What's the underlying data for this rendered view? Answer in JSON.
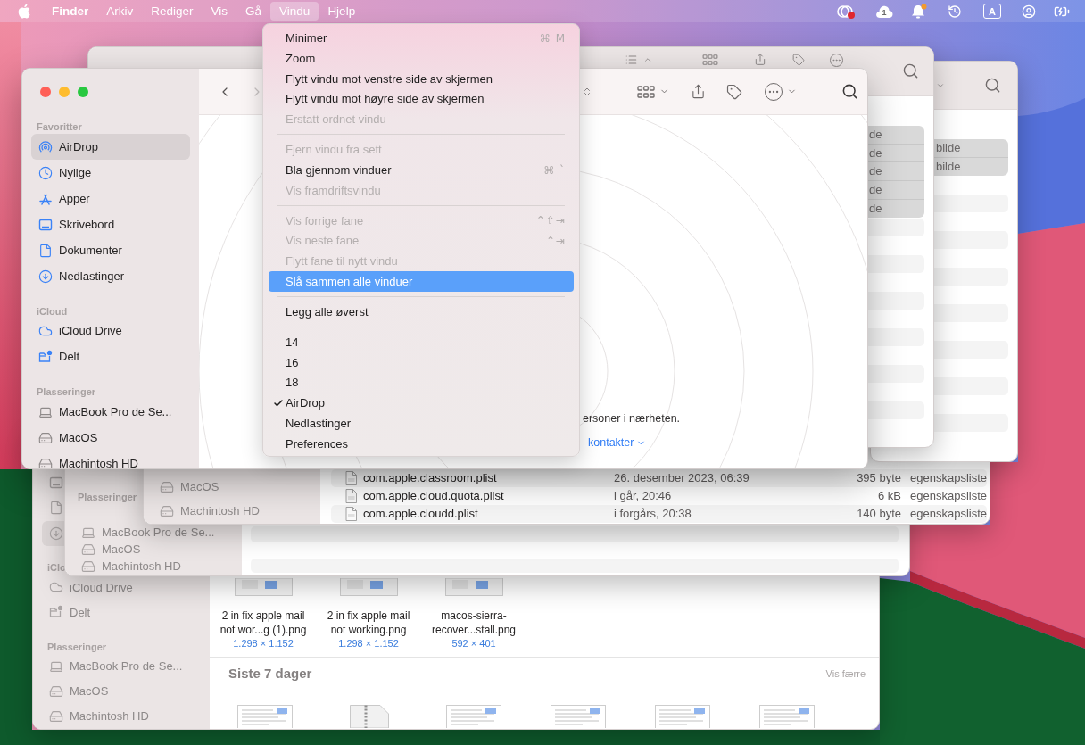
{
  "menu_bar": {
    "items": [
      {
        "label": "Finder",
        "kind": "app",
        "selected": false
      },
      {
        "label": "Arkiv",
        "kind": "menu",
        "selected": false
      },
      {
        "label": "Rediger",
        "kind": "menu",
        "selected": false
      },
      {
        "label": "Vis",
        "kind": "menu",
        "selected": false
      },
      {
        "label": "Gå",
        "kind": "menu",
        "selected": false
      },
      {
        "label": "Vindu",
        "kind": "menu",
        "selected": true
      },
      {
        "label": "Hjelp",
        "kind": "menu",
        "selected": false
      }
    ],
    "status_badge": "1",
    "input_source": "A"
  },
  "window_menu": {
    "entries": [
      {
        "kind": "item",
        "label": "Minimer",
        "shortcut": "⌘ M",
        "disabled": false,
        "selected": false,
        "checked": false
      },
      {
        "kind": "item",
        "label": "Zoom",
        "disabled": false,
        "selected": false,
        "checked": false
      },
      {
        "kind": "item",
        "label": "Flytt vindu mot venstre side av skjermen",
        "disabled": false,
        "selected": false,
        "checked": false
      },
      {
        "kind": "item",
        "label": "Flytt vindu mot høyre side av skjermen",
        "disabled": false,
        "selected": false,
        "checked": false
      },
      {
        "kind": "item",
        "label": "Erstatt ordnet vindu",
        "disabled": true,
        "selected": false,
        "checked": false
      },
      {
        "kind": "separator"
      },
      {
        "kind": "item",
        "label": "Fjern vindu fra sett",
        "disabled": true,
        "selected": false,
        "checked": false
      },
      {
        "kind": "item",
        "label": "Bla gjennom vinduer",
        "shortcut": "⌘ `",
        "disabled": false,
        "selected": false,
        "checked": false
      },
      {
        "kind": "item",
        "label": "Vis framdriftsvindu",
        "disabled": true,
        "selected": false,
        "checked": false
      },
      {
        "kind": "separator"
      },
      {
        "kind": "item",
        "label": "Vis forrige fane",
        "shortcut": "⌃⇧⇥",
        "disabled": true,
        "selected": false,
        "checked": false
      },
      {
        "kind": "item",
        "label": "Vis neste fane",
        "shortcut": "⌃⇥",
        "disabled": true,
        "selected": false,
        "checked": false
      },
      {
        "kind": "item",
        "label": "Flytt fane til nytt vindu",
        "disabled": true,
        "selected": false,
        "checked": false
      },
      {
        "kind": "item",
        "label": "Slå sammen alle vinduer",
        "disabled": false,
        "selected": true,
        "checked": false
      },
      {
        "kind": "separator"
      },
      {
        "kind": "item",
        "label": "Legg alle øverst",
        "disabled": false,
        "selected": false,
        "checked": false
      },
      {
        "kind": "separator"
      },
      {
        "kind": "item",
        "label": "14",
        "disabled": false,
        "selected": false,
        "checked": false
      },
      {
        "kind": "item",
        "label": "16",
        "disabled": false,
        "selected": false,
        "checked": false
      },
      {
        "kind": "item",
        "label": "18",
        "disabled": false,
        "selected": false,
        "checked": false
      },
      {
        "kind": "item",
        "label": "AirDrop",
        "disabled": false,
        "selected": false,
        "checked": true
      },
      {
        "kind": "item",
        "label": "Nedlastinger",
        "disabled": false,
        "selected": false,
        "checked": false
      },
      {
        "kind": "item",
        "label": "Preferences",
        "disabled": false,
        "selected": false,
        "checked": false
      }
    ]
  },
  "finder_window": {
    "navigation": {
      "back_disabled": false,
      "forward_disabled": true
    },
    "sidebar": {
      "sections": [
        {
          "title": "Favoritter",
          "items": [
            {
              "label": "AirDrop",
              "kind": "airdrop",
              "selected": true
            },
            {
              "label": "Nylige",
              "kind": "recents",
              "selected": false
            },
            {
              "label": "Apper",
              "kind": "apps",
              "selected": false
            },
            {
              "label": "Skrivebord",
              "kind": "desktop",
              "selected": false
            },
            {
              "label": "Dokumenter",
              "kind": "document",
              "selected": false
            },
            {
              "label": "Nedlastinger",
              "kind": "downloads",
              "selected": false
            }
          ]
        },
        {
          "title": "iCloud",
          "items": [
            {
              "label": "iCloud Drive",
              "kind": "icloud",
              "selected": false
            },
            {
              "label": "Delt",
              "kind": "shared",
              "selected": false
            }
          ]
        },
        {
          "title": "Plasseringer",
          "items": [
            {
              "label": "MacBook Pro de Se...",
              "kind": "laptop",
              "selected": false
            },
            {
              "label": "MacOS",
              "kind": "disk",
              "selected": false
            },
            {
              "label": "Machintosh HD",
              "kind": "disk",
              "selected": false
            }
          ]
        }
      ]
    },
    "airdrop": {
      "message": "ersoner i nærheten.",
      "link": "kontakter"
    }
  },
  "finder_window_back": {
    "rows": [
      {
        "label": "de",
        "selected": true
      },
      {
        "label": "de",
        "selected": true
      },
      {
        "label": "de",
        "selected": true
      },
      {
        "label": "de",
        "selected": true
      },
      {
        "label": "de",
        "selected": true
      }
    ]
  },
  "finder_window_right": {
    "rows": [
      {
        "label": "bilde",
        "selected": true
      },
      {
        "label": "bilde",
        "selected": true
      }
    ]
  },
  "list_window": {
    "sidebar": {
      "items": [
        {
          "label": "MacOS",
          "kind": "disk",
          "selected": false
        },
        {
          "label": "Machintosh HD",
          "kind": "disk",
          "selected": false
        }
      ]
    },
    "files": [
      {
        "name": "com.apple.classroom.plist",
        "date": "26. desember 2023, 06:39",
        "size": "395 byte",
        "file_type": "egenskapsliste"
      },
      {
        "name": "com.apple.cloud.quota.plist",
        "date": "i går, 20:46",
        "size": "6 kB",
        "file_type": "egenskapsliste"
      },
      {
        "name": "com.apple.cloudd.plist",
        "date": "i forgårs, 20:38",
        "size": "140 byte",
        "file_type": "egenskapsliste"
      }
    ]
  },
  "sidebar_window": {
    "sidebar": {
      "title": "Plasseringer",
      "items": [
        {
          "label": "MacBook Pro de Se...",
          "kind": "laptop",
          "selected": false
        },
        {
          "label": "MacOS",
          "kind": "disk",
          "selected": false
        },
        {
          "label": "Machintosh HD",
          "kind": "disk",
          "selected": false
        }
      ]
    }
  },
  "recents_window": {
    "sidebar": {
      "items": [
        {
          "kind": "desktop",
          "selected": false
        },
        {
          "kind": "document",
          "selected": false
        },
        {
          "kind": "downloads",
          "selected": true
        }
      ],
      "sections": [
        {
          "title": "iClo",
          "items": [
            {
              "label": "iCloud Drive",
              "kind": "icloud",
              "selected": false
            },
            {
              "label": "Delt",
              "kind": "shared",
              "selected": false
            }
          ]
        },
        {
          "title": "Plasseringer",
          "items": [
            {
              "label": "MacBook Pro de Se...",
              "kind": "laptop",
              "selected": false
            },
            {
              "label": "MacOS",
              "kind": "disk",
              "selected": false
            },
            {
              "label": "Machintosh HD",
              "kind": "disk",
              "selected": false
            }
          ]
        }
      ]
    },
    "images": [
      {
        "name": "2 in fix apple mail\nnot wor...g (1).png",
        "dimensions": "1.298 × 1.152"
      },
      {
        "name": "2 in fix apple mail\nnot working.png",
        "dimensions": "1.298 × 1.152"
      },
      {
        "name": "macos-sierra-\nrecover...stall.png",
        "dimensions": "592 × 401"
      }
    ],
    "group": {
      "title": "Siste 7 dager",
      "link": "Vis færre"
    }
  }
}
